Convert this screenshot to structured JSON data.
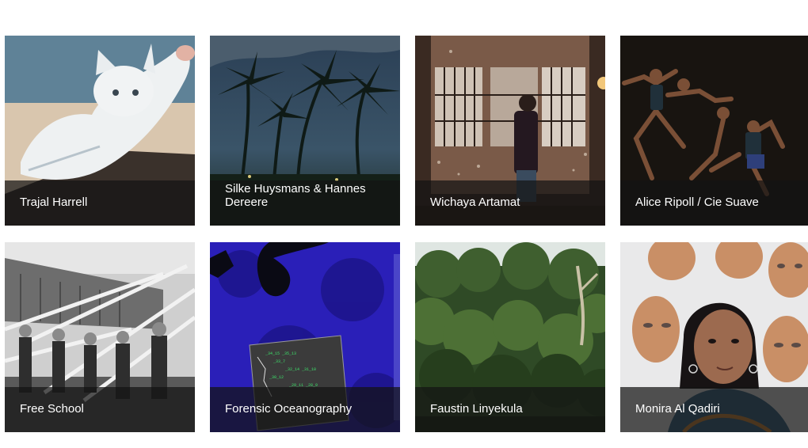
{
  "tiles": [
    {
      "name": "Trajal Harrell",
      "image": "white-cat-painting"
    },
    {
      "name": "Silke Huysmans & Hannes Dereere",
      "image": "palm-trees-dusk"
    },
    {
      "name": "Wichaya Artamat",
      "image": "person-at-window"
    },
    {
      "name": "Alice Ripoll / Cie Suave",
      "image": "dancers-leaping"
    },
    {
      "name": "Free School",
      "image": "maypole-ribbons-bw"
    },
    {
      "name": "Forensic Oceanography",
      "image": "satellite-sea-map"
    },
    {
      "name": "Faustin Linyekula",
      "image": "forest-trees"
    },
    {
      "name": "Monira Al Qadiri",
      "image": "woman-with-masks"
    }
  ]
}
